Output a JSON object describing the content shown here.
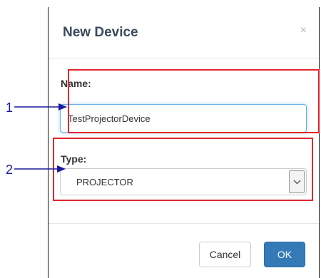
{
  "dialog": {
    "title": "New Device",
    "close_glyph": "×",
    "name_label": "Name:",
    "name_value": "TestProjectorDevice",
    "type_label": "Type:",
    "type_value": "PROJECTOR",
    "cancel_label": "Cancel",
    "ok_label": "OK"
  },
  "callouts": [
    {
      "number": "1",
      "target": "name-input"
    },
    {
      "number": "2",
      "target": "type-select"
    }
  ],
  "colors": {
    "callout_box": "#e1262d",
    "callout_arrow": "#1a1a9e",
    "primary_button": "#337ab7",
    "focus_border": "#66afe9"
  },
  "icons": {
    "close": "close-icon",
    "dropdown": "chevron-down-icon"
  }
}
